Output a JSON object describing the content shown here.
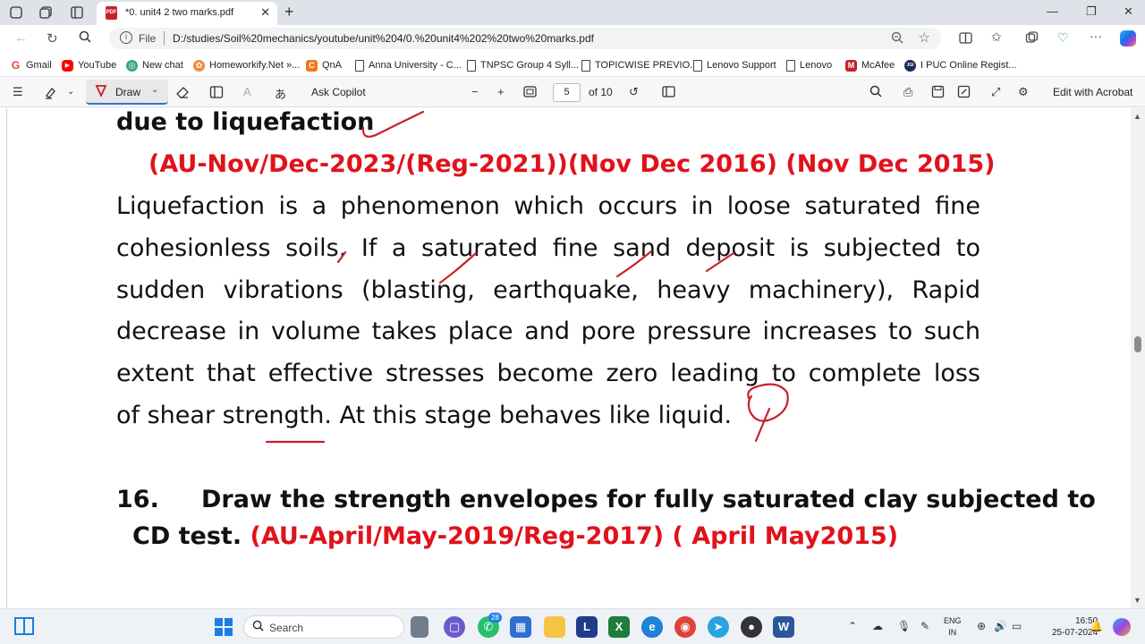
{
  "browser": {
    "tab_title": "*0. unit4 2 two marks.pdf",
    "address_prefix": "File",
    "url": "D:/studies/Soil%20mechanics/youtube/unit%204/0.%20unit4%202%20two%20marks.pdf",
    "pdf_badge": "PDF"
  },
  "bookmarks": [
    {
      "label": "Gmail",
      "icon": "G",
      "color": "#ea4335"
    },
    {
      "label": "YouTube",
      "icon": "▶",
      "color": "#ff0000"
    },
    {
      "label": "New chat",
      "icon": "◎",
      "color": "#3aa387"
    },
    {
      "label": "Homeworkify.Net »...",
      "icon": "✿",
      "color": "#f28b3c"
    },
    {
      "label": "QnA",
      "icon": "C",
      "color": "#f2761d"
    },
    {
      "label": "Anna University - C...",
      "icon": "",
      "color": ""
    },
    {
      "label": "TNPSC Group 4 Syll...",
      "icon": "",
      "color": ""
    },
    {
      "label": "TOPICWISE PREVIO...",
      "icon": "",
      "color": ""
    },
    {
      "label": "Lenovo Support",
      "icon": "",
      "color": ""
    },
    {
      "label": "Lenovo",
      "icon": "",
      "color": ""
    },
    {
      "label": "McAfee",
      "icon": "M",
      "color": "#c8202b"
    },
    {
      "label": "I PUC Online Regist...",
      "icon": "JGI",
      "color": "#1b2b55"
    }
  ],
  "pdf_toolbar": {
    "draw_label": "Draw",
    "ask_copilot": "Ask Copilot",
    "page_current": "5",
    "page_total": "of 10",
    "edit_acrobat": "Edit with Acrobat"
  },
  "document": {
    "heading_tail": "due to liquefaction",
    "references_1": "(AU-Nov/Dec-2023/(Reg-2021))(Nov Dec 2016) (Nov Dec 2015)",
    "paragraph_lines": [
      "Liquefaction is a phenomenon which occurs in loose saturated fine",
      "cohesionless soils. If a saturated fine sand deposit is subjected to",
      "sudden vibrations (blasting, earthquake, heavy machinery), Rapid",
      "decrease in volume takes place and pore pressure increases to such",
      "extent that effective stresses become zero leading to complete loss",
      "of shear strength. At this stage behaves like liquid."
    ],
    "question_number": "16.",
    "question_line_1": "Draw the strength envelopes for fully saturated clay subjected to",
    "question_line_2_black": "CD test.",
    "question_line_2_red": "(AU-April/May-2019/Reg-2017) ( April May2015)"
  },
  "taskbar": {
    "search_label": "Search",
    "badge_whatsapp": "28",
    "lang_top": "ENG",
    "lang_bottom": "IN",
    "time": "16:50",
    "date": "25-07-2024"
  },
  "colors": {
    "red_text": "#e0121c",
    "ink": "#c8202b",
    "accent": "#3b6fd4"
  }
}
